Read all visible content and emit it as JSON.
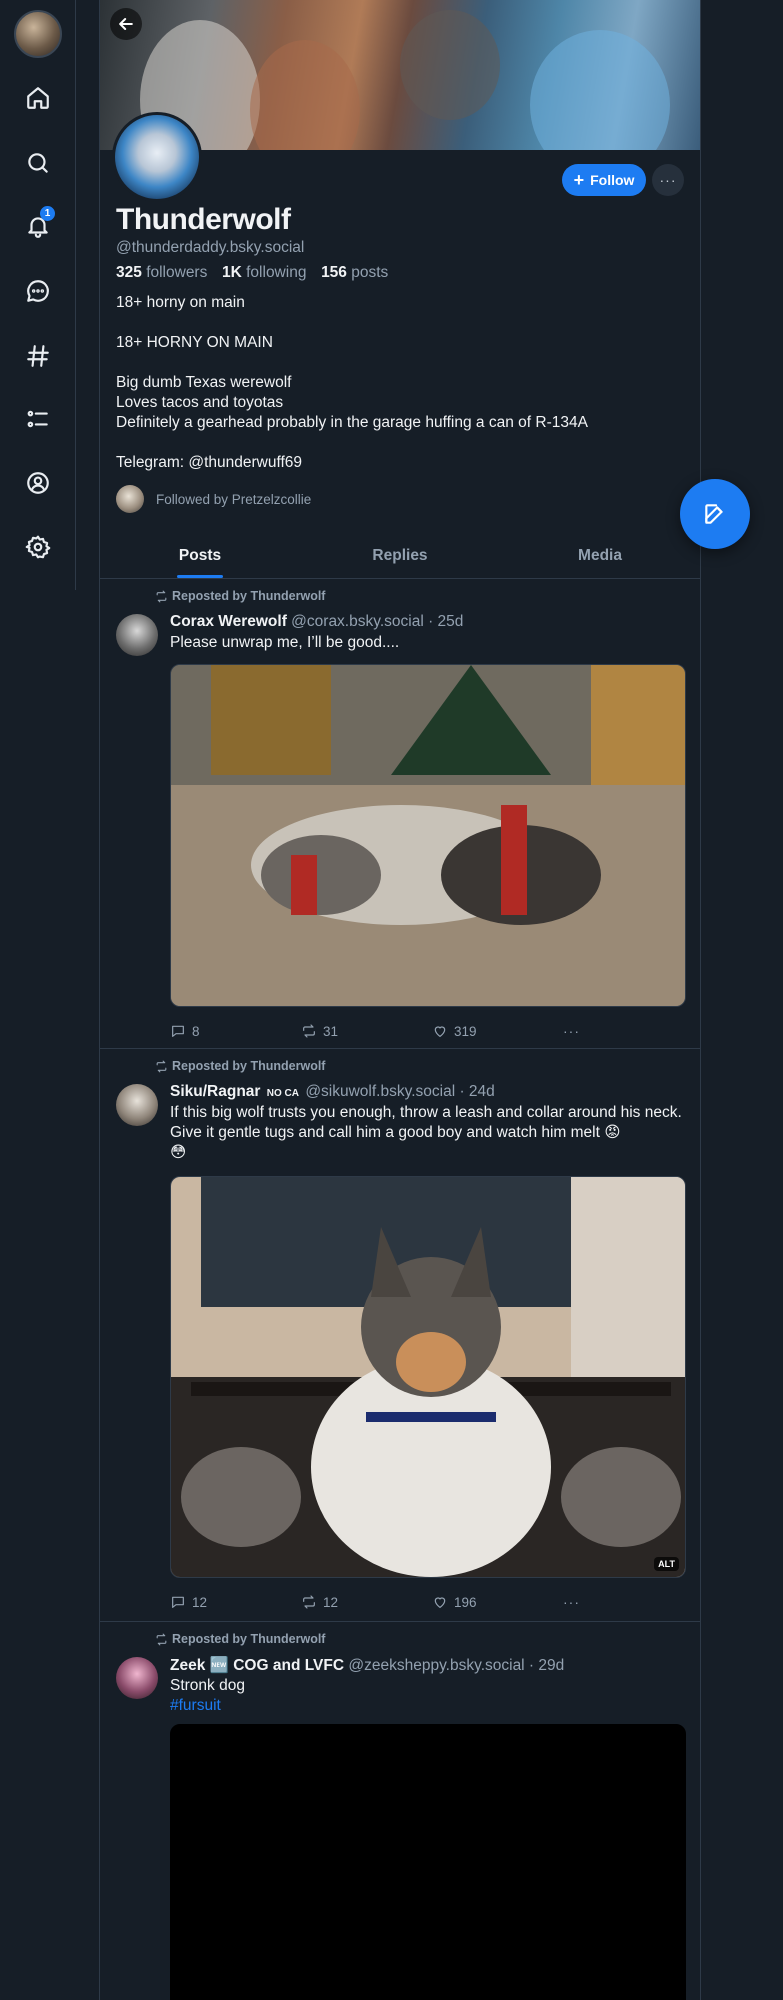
{
  "profile": {
    "display_name": "Thunderwolf",
    "handle": "@thunderdaddy.bsky.social",
    "followers_count": "325",
    "followers_label": "followers",
    "following_count": "1K",
    "following_label": "following",
    "posts_count": "156",
    "posts_label": "posts",
    "bio_lines": [
      "18+ horny on main",
      "",
      "18+ HORNY ON MAIN",
      "",
      "Big dumb Texas werewolf",
      "Loves tacos and toyotas",
      "Definitely a gearhead probably in the garage huffing a can of R-134A",
      "",
      "Telegram: @thunderwuff69"
    ],
    "followed_by": "Followed by Pretzelzcollie",
    "follow_label": "Follow",
    "more_label": "···"
  },
  "nav": {
    "notification_badge": "1"
  },
  "tabs": [
    {
      "label": "Posts",
      "active": true
    },
    {
      "label": "Replies",
      "active": false
    },
    {
      "label": "Media",
      "active": false
    }
  ],
  "posts": [
    {
      "repost_label": "Reposted by Thunderwolf",
      "author": "Corax Werewolf",
      "meta": "@corax.bsky.social · 25d",
      "text": "Please unwrap me, I’ll be good....",
      "replies": "8",
      "reposts": "31",
      "likes": "319"
    },
    {
      "repost_label": "Reposted by Thunderwolf",
      "author": "Siku/Ragnar",
      "author_flag": "NO CA",
      "meta": "@sikuwolf.bsky.social · 24d",
      "text": "If this big wolf trusts you enough, throw a leash and collar around his neck. Give it gentle tugs and call him a good boy and watch him melt 😡\n😳",
      "alt_label": "ALT",
      "replies": "12",
      "reposts": "12",
      "likes": "196"
    },
    {
      "repost_label": "Reposted by Thunderwolf",
      "author": "Zeek 🆕 COG and LVFC",
      "meta": "@zeeksheppy.bsky.social · 29d",
      "text": "Stronk dog",
      "hashtag": "#fursuit"
    }
  ],
  "colors": {
    "accent": "#1d7cf2",
    "background": "#161e27",
    "muted_text": "#93a1b0",
    "border": "#2e3a48"
  }
}
